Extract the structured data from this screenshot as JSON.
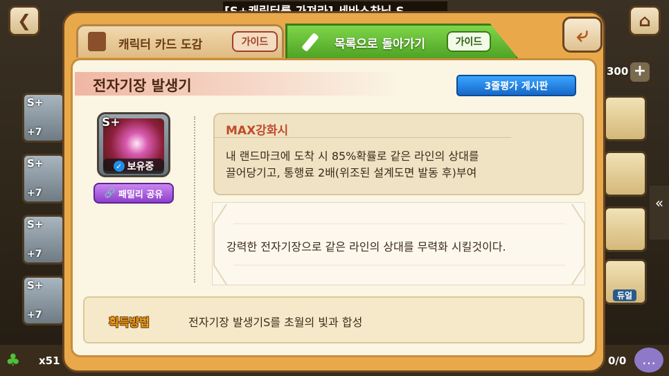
{
  "ticker": {
    "text": "[S+캐릭터를 가져라] 세바스찬님 S"
  },
  "background": {
    "right_value": "300",
    "clover_count": "x51",
    "bottom_right_count": "0/0",
    "duel_label": "듀얼",
    "side_card_grade": "S+",
    "side_card_level": "+7"
  },
  "tabs": {
    "card_collection": "캐릭터 카드 도감",
    "card_collection_guide": "가이드",
    "back_to_list": "목록으로 돌아가기",
    "back_to_list_guide": "가이드"
  },
  "item": {
    "title": "전자기장 발생기",
    "grade": "S+",
    "owned_label": "보유중",
    "family_share_label": "패밀리 공유",
    "review_board_label": "3줄평가 게시판",
    "max_title": "MAX강화시",
    "max_desc_line1": "내 랜드마크에 도착 시 85%확률로 같은 라인의 상대를",
    "max_desc_line2": "끌어당기고, 통행료 2배(위조된 설계도면 발동 후)부여",
    "flavor": "강력한 전자기장으로 같은 라인의 상대를 무력화 시킬것이다.",
    "acquire_label": "획득방법",
    "acquire_text": "전자기장 발생기S를 초월의 빛과 합성"
  },
  "colors": {
    "panel_orange": "#e9a94a",
    "tab_green": "#5cb52c",
    "review_blue": "#1f84e0",
    "family_purple": "#a457dc",
    "max_red": "#c14a2a"
  }
}
